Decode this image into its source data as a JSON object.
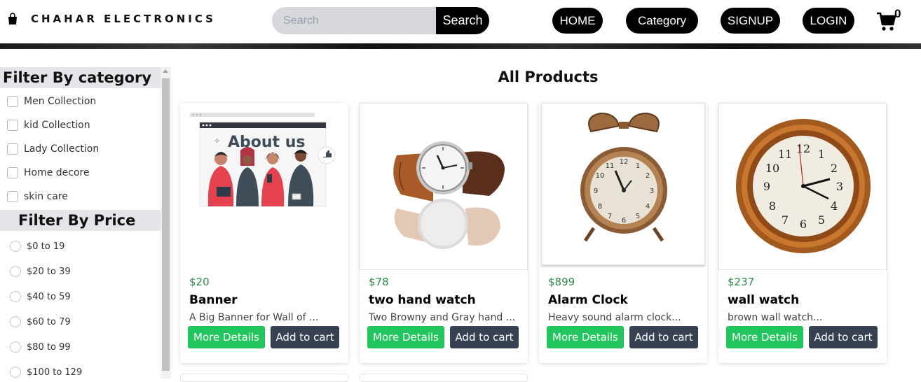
{
  "navbar": {
    "brand": "CHAHAR ELECTRONICS",
    "search_placeholder": "Search",
    "search_button": "Search",
    "links": [
      "HOME",
      "Category",
      "SIGNUP",
      "LOGIN"
    ],
    "cart_count": "0"
  },
  "sidebar": {
    "category_heading": "Filter By category",
    "categories": [
      "Men Collection",
      "kid Collection",
      "Lady Collection",
      "Home decore",
      "skin care"
    ],
    "price_heading": "Filter By Price",
    "prices": [
      "$0 to 19",
      "$20 to 39",
      "$40 to 59",
      "$60 to 79",
      "$80 to 99",
      "$100 to 129"
    ]
  },
  "main": {
    "title": "All Products",
    "banner_text": "About us",
    "details_label": "More Details",
    "cart_label": "Add to cart",
    "products": [
      {
        "price": "$20",
        "name": "Banner",
        "desc": "A Big Banner for Wall of ..."
      },
      {
        "price": "$78",
        "name": "two hand watch",
        "desc": "Two Browny and Gray hand ..."
      },
      {
        "price": "$899",
        "name": "Alarm Clock",
        "desc": "Heavy sound alarm clock..."
      },
      {
        "price": "$237",
        "name": "wall watch",
        "desc": "brown wall watch..."
      }
    ]
  },
  "colors": {
    "price_green": "#2c8a4b",
    "details_button": "#22c55e",
    "cart_button": "#374151",
    "nav_black": "#000000"
  }
}
